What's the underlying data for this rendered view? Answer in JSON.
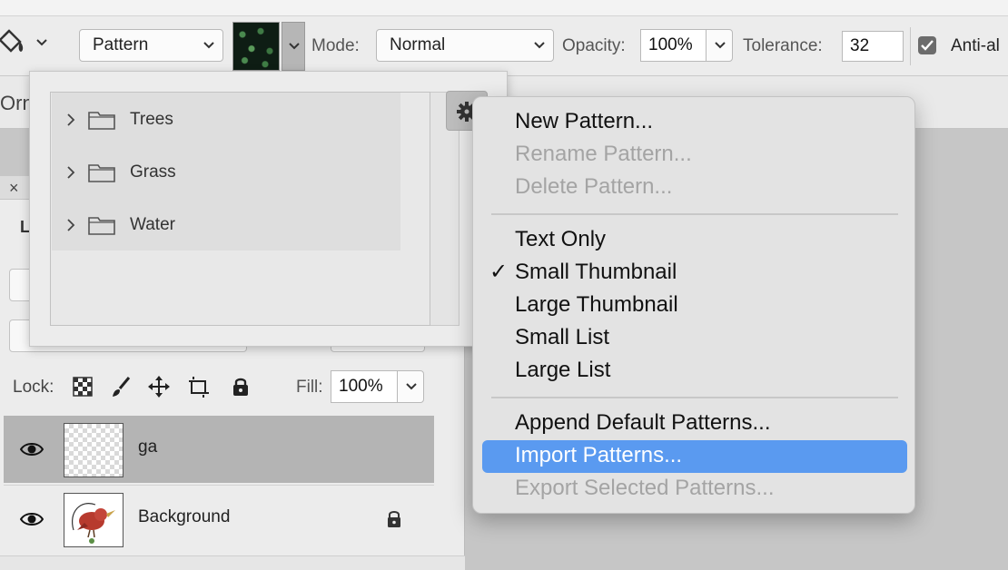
{
  "toolbar": {
    "tool_icon": "paint-bucket-icon",
    "source_select": "Pattern",
    "mode_label": "Mode:",
    "mode_value": "Normal",
    "opacity_label": "Opacity:",
    "opacity_value": "100%",
    "tolerance_label": "Tolerance:",
    "tolerance_value": "32",
    "antialias_label": "Anti-al",
    "antialias_checked": true
  },
  "second_bar": {
    "partial_text": "Orn"
  },
  "pattern_picker": {
    "folders": [
      {
        "label": "Trees"
      },
      {
        "label": "Grass"
      },
      {
        "label": "Water"
      }
    ],
    "settings_icon": "gear-icon"
  },
  "menu": {
    "group1": [
      {
        "label": "New Pattern...",
        "enabled": true
      },
      {
        "label": "Rename Pattern...",
        "enabled": false
      },
      {
        "label": "Delete Pattern...",
        "enabled": false
      }
    ],
    "group2": [
      {
        "label": "Text Only",
        "checked": false
      },
      {
        "label": "Small Thumbnail",
        "checked": true
      },
      {
        "label": "Large Thumbnail",
        "checked": false
      },
      {
        "label": "Small List",
        "checked": false
      },
      {
        "label": "Large List",
        "checked": false
      }
    ],
    "group3": [
      {
        "label": "Append Default Patterns...",
        "enabled": true
      },
      {
        "label": "Import Patterns...",
        "enabled": true,
        "highlighted": true
      },
      {
        "label": "Export Selected Patterns...",
        "enabled": false
      }
    ],
    "checkmark": "✓",
    "highlight_color": "#5a9af0"
  },
  "layers_panel": {
    "close_glyph": "×",
    "tab_initial": "L",
    "lock_label": "Lock:",
    "fill_label": "Fill:",
    "fill_value": "100%",
    "layers": [
      {
        "name": "ga",
        "selected": true,
        "locked": false
      },
      {
        "name": "Background",
        "selected": false,
        "locked": true
      }
    ]
  }
}
